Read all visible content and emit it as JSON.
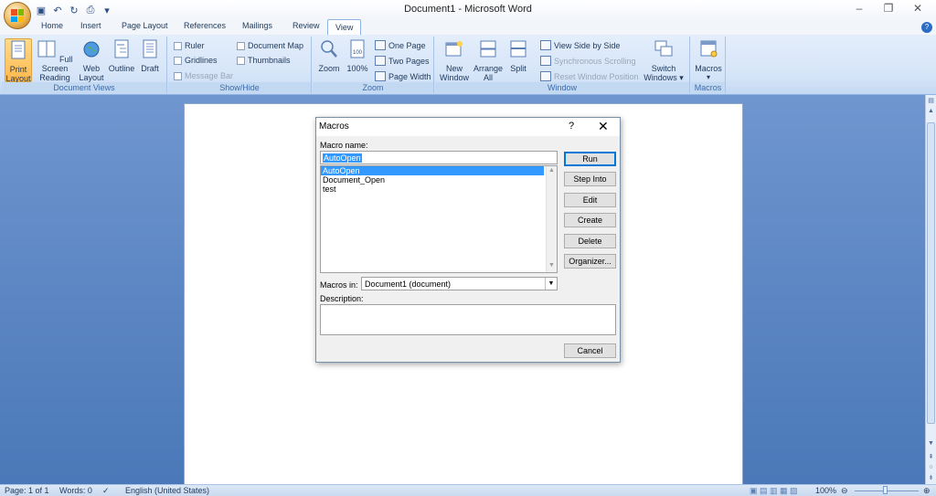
{
  "window": {
    "title": "Document1 - Microsoft Word",
    "controls": [
      "–",
      "❐",
      "✕"
    ]
  },
  "quick_access": {
    "items": [
      "save-icon",
      "undo-icon",
      "redo-icon",
      "print-preview-icon",
      "customize-icon"
    ]
  },
  "tabs": [
    {
      "label": "Home"
    },
    {
      "label": "Insert"
    },
    {
      "label": "Page Layout"
    },
    {
      "label": "References"
    },
    {
      "label": "Mailings"
    },
    {
      "label": "Review"
    },
    {
      "label": "View",
      "active": true
    }
  ],
  "ribbon": {
    "document_views": {
      "label": "Document Views",
      "print_layout": "Print Layout",
      "full_screen_reading": "Full Screen Reading",
      "web_layout": "Web Layout",
      "outline": "Outline",
      "draft": "Draft"
    },
    "show_hide": {
      "label": "Show/Hide",
      "ruler": "Ruler",
      "gridlines": "Gridlines",
      "message_bar": "Message Bar",
      "document_map": "Document Map",
      "thumbnails": "Thumbnails"
    },
    "zoom": {
      "label": "Zoom",
      "zoom": "Zoom",
      "hundred": "100%",
      "one_page": "One Page",
      "two_pages": "Two Pages",
      "page_width": "Page Width"
    },
    "window": {
      "label": "Window",
      "new_window": "New Window",
      "arrange_all": "Arrange All",
      "split": "Split",
      "view_side_by_side": "View Side by Side",
      "synchronous_scrolling": "Synchronous Scrolling",
      "reset_window_position": "Reset Window Position",
      "switch_windows": "Switch Windows"
    },
    "macros": {
      "label": "Macros",
      "macros": "Macros"
    }
  },
  "statusbar": {
    "page": "Page: 1 of 1",
    "words": "Words: 0",
    "language": "English (United States)",
    "zoom": "100%"
  },
  "dialog": {
    "title": "Macros",
    "help": "?",
    "close": "✕",
    "macro_name_label": "Macro name:",
    "macro_name_value": "AutoOpen",
    "macros": [
      "AutoOpen",
      "Document_Open",
      "test"
    ],
    "selected_index": 0,
    "buttons": {
      "run": "Run",
      "step_into": "Step Into",
      "edit": "Edit",
      "create": "Create",
      "delete": "Delete",
      "organizer": "Organizer..."
    },
    "macros_in_label": "Macros in:",
    "macros_in_value": "Document1 (document)",
    "description_label": "Description:",
    "cancel": "Cancel"
  }
}
